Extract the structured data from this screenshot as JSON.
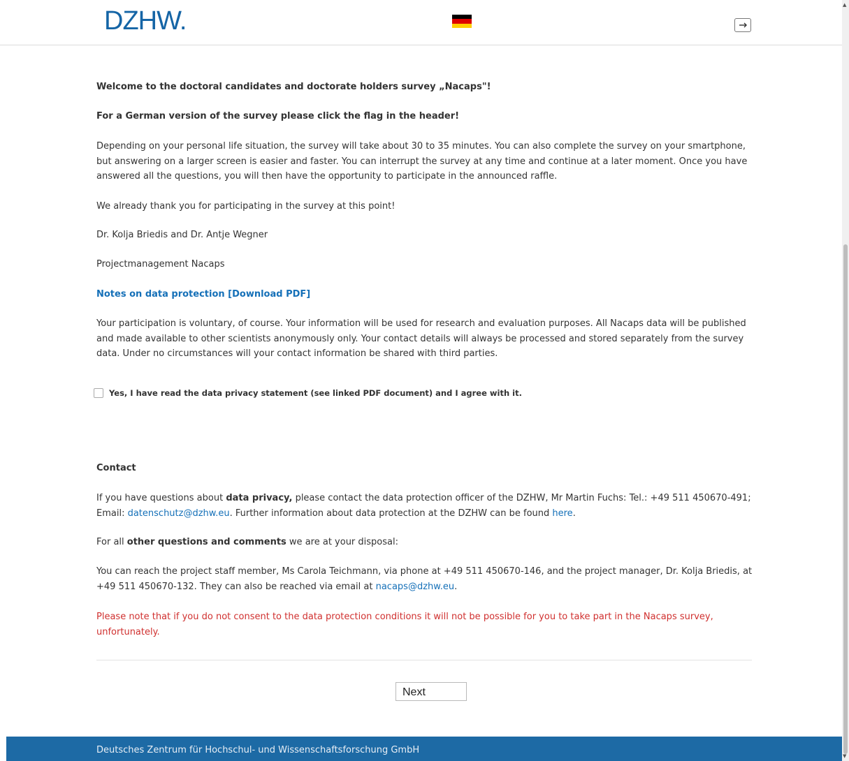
{
  "header": {
    "logo_text": "DZHW.",
    "flag": {
      "colors": [
        "#000000",
        "#dd0000",
        "#ffce00"
      ]
    },
    "logout_icon": "logout-icon"
  },
  "intro": {
    "welcome": "Welcome to the doctoral candidates and doctorate holders survey „Nacaps\"!",
    "german_hint": "For a German version of the survey please click the flag in the header!",
    "duration": "Depending on your personal life situation, the survey will take about 30 to 35 minutes. You can also complete the survey on your smartphone, but answering on a larger screen is easier and faster. You can interrupt the survey at any time and continue at a later moment. Once you have answered all the questions, you will then have the opportunity to participate in the announced raffle.",
    "thanks": "We already thank you for participating in the survey at this point!",
    "names": "Dr. Kolja Briedis and Dr. Antje Wegner",
    "project_management": "Projectmanagement Nacaps",
    "notes_link": "Notes on data protection [Download PDF]",
    "participation": "Your participation is voluntary, of course. Your information will be used for research and evaluation purposes. All Nacaps data will be published and made available to other scientists anonymously only. Your contact details will always be processed and stored separately from the survey data. Under no circumstances will your contact information be shared with third parties."
  },
  "consent": {
    "label": "Yes, I have read the data privacy statement (see linked PDF document) and I agree with it.",
    "checked": false
  },
  "contact": {
    "heading": "Contact",
    "privacy_pre": "If you have questions about ",
    "privacy_bold": "data privacy,",
    "privacy_mid": " please contact the data protection officer of the DZHW, Mr Martin Fuchs: Tel.: +49 511 450670-491; Email: ",
    "privacy_email": "datenschutz@dzhw.eu",
    "privacy_post": ". Further information about data protection at the DZHW can be found ",
    "privacy_here": "here",
    "privacy_end": ".",
    "other_pre": "For all ",
    "other_bold": "other questions and comments",
    "other_post": " we are at your disposal:",
    "reach_text": "You can reach the project staff member, Ms Carola Teichmann, via phone at +49 511 450670-146, and the project manager, Dr. Kolja Briedis, at +49 511 450670-132. They can also be reached via email at ",
    "reach_email": "nacaps@dzhw.eu",
    "reach_end": ".",
    "warning": "Please note that if you do not consent to the data protection conditions it will not be possible for you to take part in the Nacaps survey, unfortunately."
  },
  "next_button": "Next",
  "footer": {
    "text": "Deutsches Zentrum für Hochschul- und Wissenschaftsforschung GmbH"
  }
}
